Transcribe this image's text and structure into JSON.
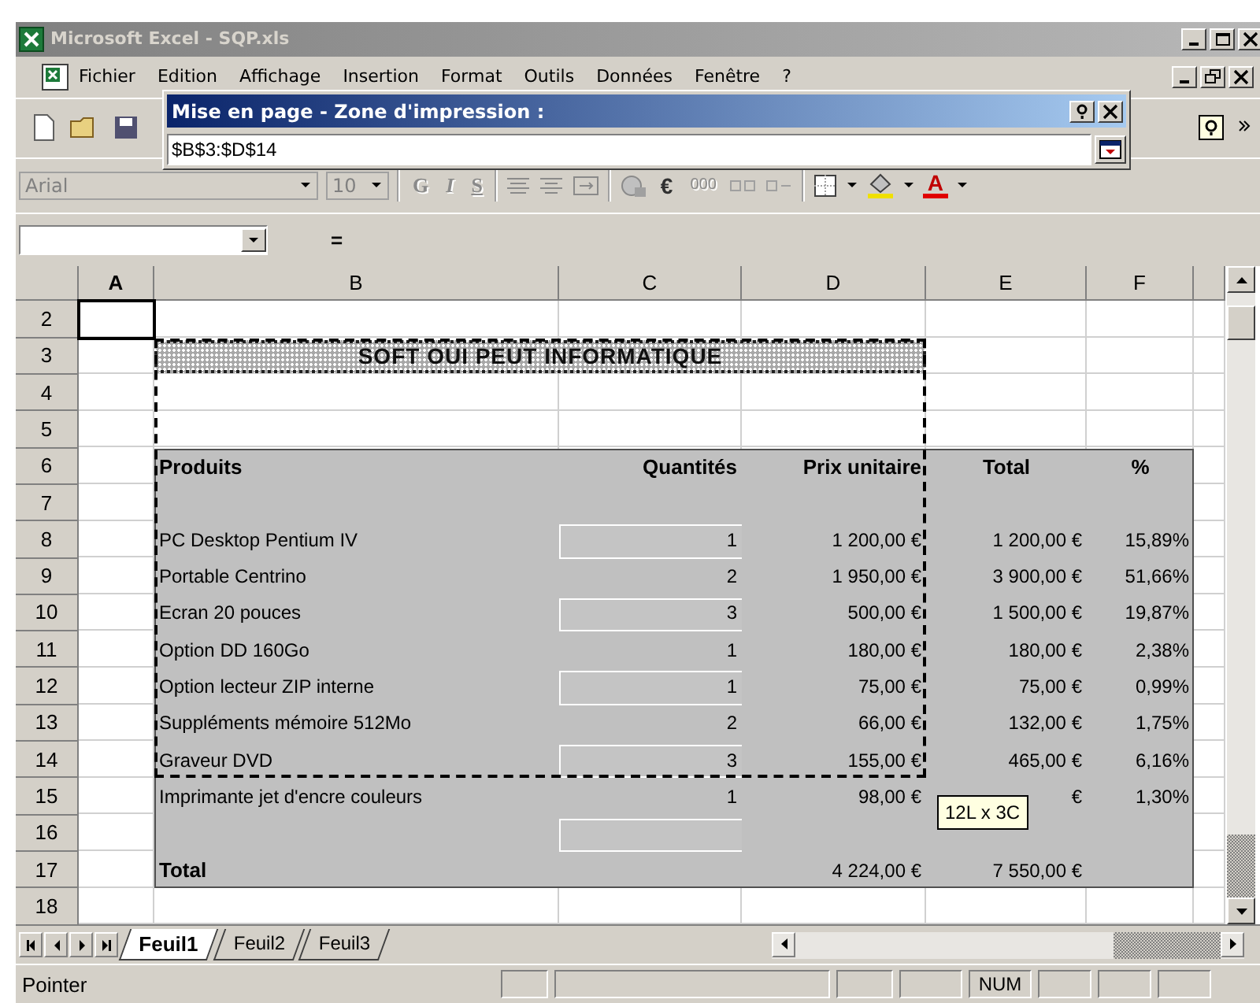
{
  "window": {
    "title": "Microsoft Excel - SQP.xls"
  },
  "menu": [
    "Fichier",
    "Edition",
    "Affichage",
    "Insertion",
    "Format",
    "Outils",
    "Données",
    "Fenêtre",
    "?"
  ],
  "formatting_toolbar": {
    "font": "Arial",
    "size": "10",
    "style_buttons": [
      "G",
      "I",
      "S"
    ],
    "euro_button": "€",
    "thousands_button": "000",
    "font_color_button": "A"
  },
  "formula_bar": {
    "equals_sign": "="
  },
  "dialog": {
    "title": "Mise en page - Zone d'impression :",
    "value": "$B$3:$D$14"
  },
  "columns": [
    "A",
    "B",
    "C",
    "D",
    "E",
    "F"
  ],
  "rows": [
    {
      "number": "2",
      "kind": "blank",
      "active_cell_a": true,
      "boxed": false
    },
    {
      "number": "3",
      "kind": "title",
      "active_cell_a": false,
      "boxed": false,
      "b": "SOFT OUI PEUT INFORMATIQUE"
    },
    {
      "number": "4",
      "kind": "blank",
      "active_cell_a": false,
      "boxed": false
    },
    {
      "number": "5",
      "kind": "blank",
      "active_cell_a": false,
      "boxed": false
    },
    {
      "number": "6",
      "kind": "header",
      "active_cell_a": false,
      "boxed": false,
      "b": "Produits",
      "c": "Quantités",
      "d": "Prix unitaire",
      "e": "Total",
      "f": "%"
    },
    {
      "number": "7",
      "kind": "spacer",
      "active_cell_a": false,
      "boxed": false
    },
    {
      "number": "8",
      "kind": "item",
      "active_cell_a": false,
      "boxed": true,
      "b": "PC Desktop Pentium IV",
      "c": "1",
      "d": "1 200,00 €",
      "e": "1 200,00 €",
      "f": "15,89%"
    },
    {
      "number": "9",
      "kind": "item",
      "active_cell_a": false,
      "boxed": false,
      "b": "Portable Centrino",
      "c": "2",
      "d": "1 950,00 €",
      "e": "3 900,00 €",
      "f": "51,66%"
    },
    {
      "number": "10",
      "kind": "item",
      "active_cell_a": false,
      "boxed": true,
      "b": "Ecran 20 pouces",
      "c": "3",
      "d": "500,00 €",
      "e": "1 500,00 €",
      "f": "19,87%"
    },
    {
      "number": "11",
      "kind": "item",
      "active_cell_a": false,
      "boxed": false,
      "b": "Option DD 160Go",
      "c": "1",
      "d": "180,00 €",
      "e": "180,00 €",
      "f": "2,38%"
    },
    {
      "number": "12",
      "kind": "item",
      "active_cell_a": false,
      "boxed": true,
      "b": "Option lecteur ZIP interne",
      "c": "1",
      "d": "75,00 €",
      "e": "75,00 €",
      "f": "0,99%"
    },
    {
      "number": "13",
      "kind": "item",
      "active_cell_a": false,
      "boxed": false,
      "b": "Suppléments mémoire 512Mo",
      "c": "2",
      "d": "66,00 €",
      "e": "132,00 €",
      "f": "1,75%"
    },
    {
      "number": "14",
      "kind": "item",
      "active_cell_a": false,
      "boxed": true,
      "b": "Graveur DVD",
      "c": "3",
      "d": "155,00 €",
      "e": "465,00 €",
      "f": "6,16%"
    },
    {
      "number": "15",
      "kind": "item",
      "active_cell_a": false,
      "boxed": false,
      "b": "Imprimante jet d'encre couleurs",
      "c": "1",
      "d": "98,00 €",
      "e": "€",
      "f": "1,30%"
    },
    {
      "number": "16",
      "kind": "spacer",
      "active_cell_a": false,
      "boxed": true
    },
    {
      "number": "17",
      "kind": "total",
      "active_cell_a": false,
      "boxed": false,
      "b": "Total",
      "d": "4 224,00 €",
      "e": "7 550,00 €"
    },
    {
      "number": "18",
      "kind": "blank",
      "active_cell_a": false,
      "boxed": false
    }
  ],
  "selection_tooltip": "12L x 3C",
  "sheet_tabs": [
    {
      "label": "Feuil1",
      "selected": true
    },
    {
      "label": "Feuil2",
      "selected": false
    },
    {
      "label": "Feuil3",
      "selected": false
    }
  ],
  "status_bar": {
    "mode": "Pointer",
    "num_lock": "NUM"
  }
}
